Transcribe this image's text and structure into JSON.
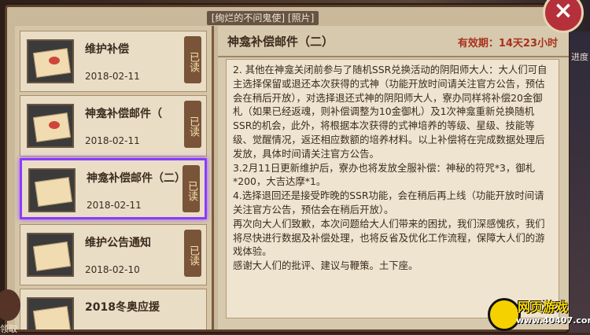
{
  "window": {
    "title": "[绚烂的不问鬼使] [照片]",
    "close_label": "×"
  },
  "mail_list": [
    {
      "title": "维护补偿",
      "date": "2018-02-11",
      "status": "已读"
    },
    {
      "title": "神龛补偿邮件（",
      "date": "2018-02-11",
      "status": "已读"
    },
    {
      "title": "神龛补偿邮件（二）",
      "date": "2018-02-11",
      "status": "已读"
    },
    {
      "title": "维护公告通知",
      "date": "2018-02-10",
      "status": "已读"
    },
    {
      "title": "2018冬奥应援",
      "date": "",
      "status": ""
    }
  ],
  "detail": {
    "title": "神龛补偿邮件（二）",
    "validity": "有效期：14天23小时",
    "paragraphs": [
      "2. 其他在神龛关闭前参与了随机SSR兑换活动的阴阳师大人：大人们可自主选择保留或退还本次获得的式神（功能开放时间请关注官方公告，预估会在稍后开放），对选择退还式神的阴阳师大人，寮办同样将补偿20金御札（如果已经返魂，则补偿调整为10金御札）及1次神龛重新兑换随机SSR的机会，此外，将根据本次获得的式神培养的等级、星级、技能等级、觉醒情况，返还相应数额的培养材料。以上补偿将在完成数据处理后发放，具体时间请关注官方公告。",
      "3.2月11日更新维护后，寮办也将发放全服补偿：神秘的符咒*3，御札*200，大吉达摩*1。",
      "4.选择退回还是接受昨晚的SSR功能，会在稍后再上线（功能开放时间请关注官方公告，预估会在稍后开放）。",
      "再次向大人们致歉，本次问题给大人们带来的困扰，我们深感愧疚，我们将尽快进行数据及补偿处理，也将反省及优化工作流程，保障大人们的游戏体验。",
      "感谢大人们的批评、建议与鞭策。土下座。"
    ]
  },
  "side": {
    "right_text": "进度",
    "left_text": "领取"
  },
  "watermark": {
    "title": "网页游戏",
    "url": "www.40407.com"
  }
}
